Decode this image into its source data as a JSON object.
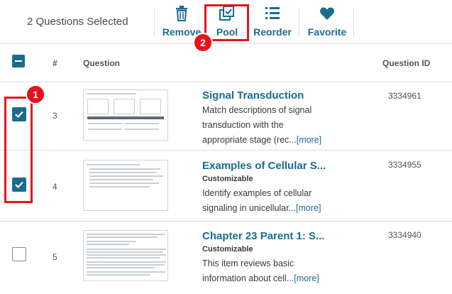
{
  "toolbar": {
    "selected_text": "2 Questions Selected",
    "remove_label": "Remove",
    "pool_label": "Pool",
    "reorder_label": "Reorder",
    "favorite_label": "Favorite"
  },
  "callouts": [
    "1",
    "2"
  ],
  "columns": {
    "number": "#",
    "question": "Question",
    "question_id": "Question ID"
  },
  "rows": [
    {
      "checked": true,
      "number": "3",
      "title": "Signal Transduction",
      "subtitle": "",
      "description": "Match descriptions of signal transduction with the appropriate stage (rec...",
      "more": "[more]",
      "question_id": "3334961"
    },
    {
      "checked": true,
      "number": "4",
      "title": "Examples of Cellular S...",
      "subtitle": "Customizable",
      "description": "Identify examples of cellular signaling in unicellular...",
      "more": "[more]",
      "question_id": "3334955"
    },
    {
      "checked": false,
      "number": "5",
      "title": "Chapter 23 Parent 1: S...",
      "subtitle": "Customizable",
      "description": "This item reviews basic information about cell...",
      "more": "[more]",
      "question_id": "3334940"
    }
  ],
  "colors": {
    "accent": "#1b6b8f",
    "highlight": "#e8121c"
  }
}
